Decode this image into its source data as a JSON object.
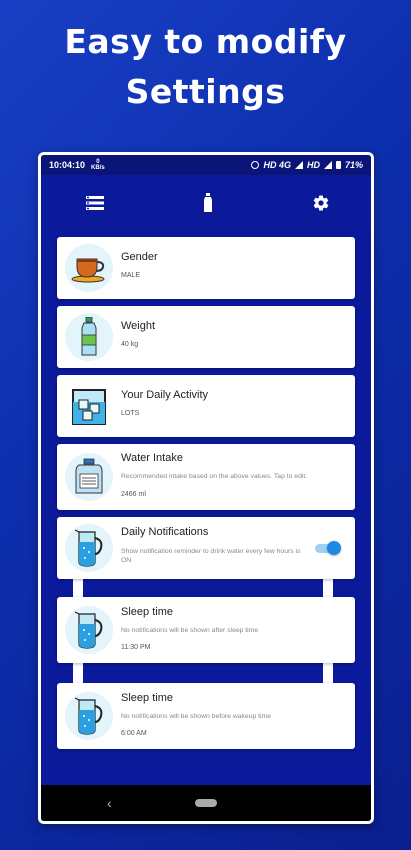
{
  "headline": {
    "line1": "Easy to modify",
    "line2": "Settings"
  },
  "status": {
    "time": "10:04:10",
    "net_speed": "0",
    "net_unit": "KB/s",
    "network": "HD 4G",
    "hd": "HD",
    "battery": "71%"
  },
  "toolbar": {
    "left_icon": "list-icon",
    "center_icon": "bottle-icon",
    "right_icon": "gear-icon"
  },
  "cards": [
    {
      "title": "Gender",
      "value": "MALE",
      "icon": "tea-cup-icon"
    },
    {
      "title": "Weight",
      "value": "40 kg",
      "icon": "water-bottle-icon"
    },
    {
      "title": "Your Daily Activity",
      "value": "LOTS",
      "icon": "ice-glass-icon"
    },
    {
      "title": "Water Intake",
      "description": "Recommended intake based on the above values. Tap to edit.",
      "value": "2466 ml",
      "icon": "water-jug-icon"
    },
    {
      "title": "Daily Notifications",
      "description": "Show notification reminder to drink water every few hours is ON",
      "toggle_on": true,
      "icon": "pitcher-icon"
    },
    {
      "title": "Sleep time",
      "description": "No notifications will be shown after sleep time",
      "value": "11:30 PM",
      "icon": "pitcher-icon"
    },
    {
      "title": "Sleep time",
      "description": "No notifications will be shown before wakeup time",
      "value": "6:00 AM",
      "icon": "pitcher-icon"
    }
  ],
  "navbar": {
    "back_glyph": "‹"
  },
  "colors": {
    "accent": "#1e88e5",
    "background": "#0a1a9a",
    "brand_gradient_start": "#1a3fc4"
  }
}
